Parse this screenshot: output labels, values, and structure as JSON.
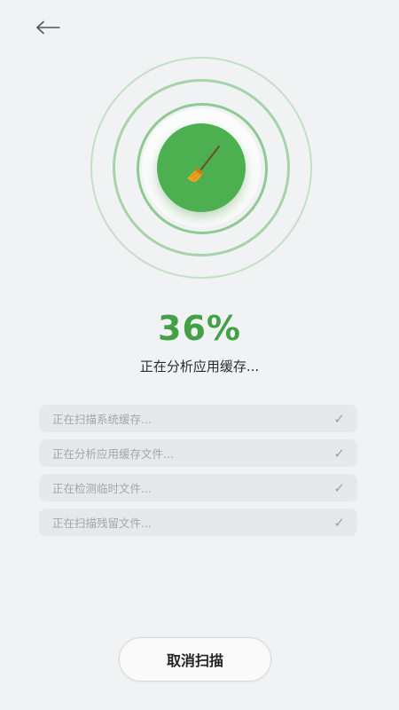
{
  "header": {
    "back_icon": "arrow-left-icon"
  },
  "scan": {
    "progress_percent": 36,
    "progress_text": "36%",
    "status_text": "正在分析应用缓存...",
    "center_icon": "broom-icon",
    "accent_color": "#4caf50"
  },
  "tasks": [
    {
      "label": "正在扫描系统缓存...",
      "done": true,
      "icon": "check-icon"
    },
    {
      "label": "正在分析应用缓存文件...",
      "done": true,
      "icon": "check-icon"
    },
    {
      "label": "正在检测临时文件...",
      "done": true,
      "icon": "check-icon"
    },
    {
      "label": "正在扫描残留文件...",
      "done": true,
      "icon": "check-icon"
    }
  ],
  "actions": {
    "cancel_label": "取消扫描"
  }
}
